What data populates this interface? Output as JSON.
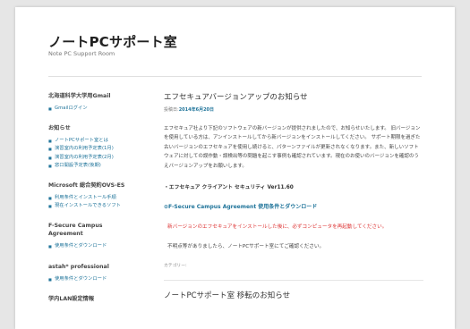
{
  "site": {
    "title": "ノートPCサポート室",
    "description": "Note PC Support Room"
  },
  "sidebar": {
    "widgets": [
      {
        "title": "北海道科学大学用Gmail",
        "items": [
          "Gmailログイン"
        ]
      },
      {
        "title": "お知らせ",
        "items": [
          "ノートPCサポート室とは",
          "演習室内の利用予定表(1月)",
          "演習室内の利用予定表(2月)",
          "窓口開設予定表(後期)"
        ]
      },
      {
        "title": "Microsoft 総合契約OVS-ES",
        "items": [
          "利用条件とインストール手順",
          "現在インストールできるソフト"
        ]
      },
      {
        "title": "F-Secure Campus Agreement",
        "items": [
          "使用条件とダウンロード"
        ]
      },
      {
        "title": "astah* professional",
        "items": [
          "使用条件とダウンロード"
        ]
      },
      {
        "title": "学内LAN設定情報",
        "items": []
      }
    ]
  },
  "post": {
    "title": "エフセキュアバージョンアップのお知らせ",
    "meta_prefix": "投稿日:",
    "date": "2014年6月20日",
    "body": "エフセキュア社より下記のソフトウェアの新バージョンが提供されましたので、お知らせいたします。 旧バージョンを使用している方は、アンインストールしてから新バージョンをインストールしてください。 サポート期限を過ぎた古いバージョンのエフセキュアを使用し続けると、パターンファイルが更新されなくなります。また、新しいソフトウェアに対しての誤作動・誤検出等の問題を起こす事例も確認されています。現在のお使いのバージョンを確認のうえバージョンアップをお願いします。",
    "product": "・エフセキュア クライアント セキュリティ Ver11.60",
    "link_mark": "⊙",
    "link": "F-Secure Campus Agreement 使用条件とダウンロード",
    "warning": "新バージョンのエフセキュアをインストールした後に、必ずコンピュータを再起動してください。",
    "contact": "不明点等がありましたら、ノートPCサポート室にてご確認ください。",
    "category": "カテゴリー:"
  },
  "next_post": {
    "title": "ノートPCサポート室 移転のお知らせ"
  }
}
